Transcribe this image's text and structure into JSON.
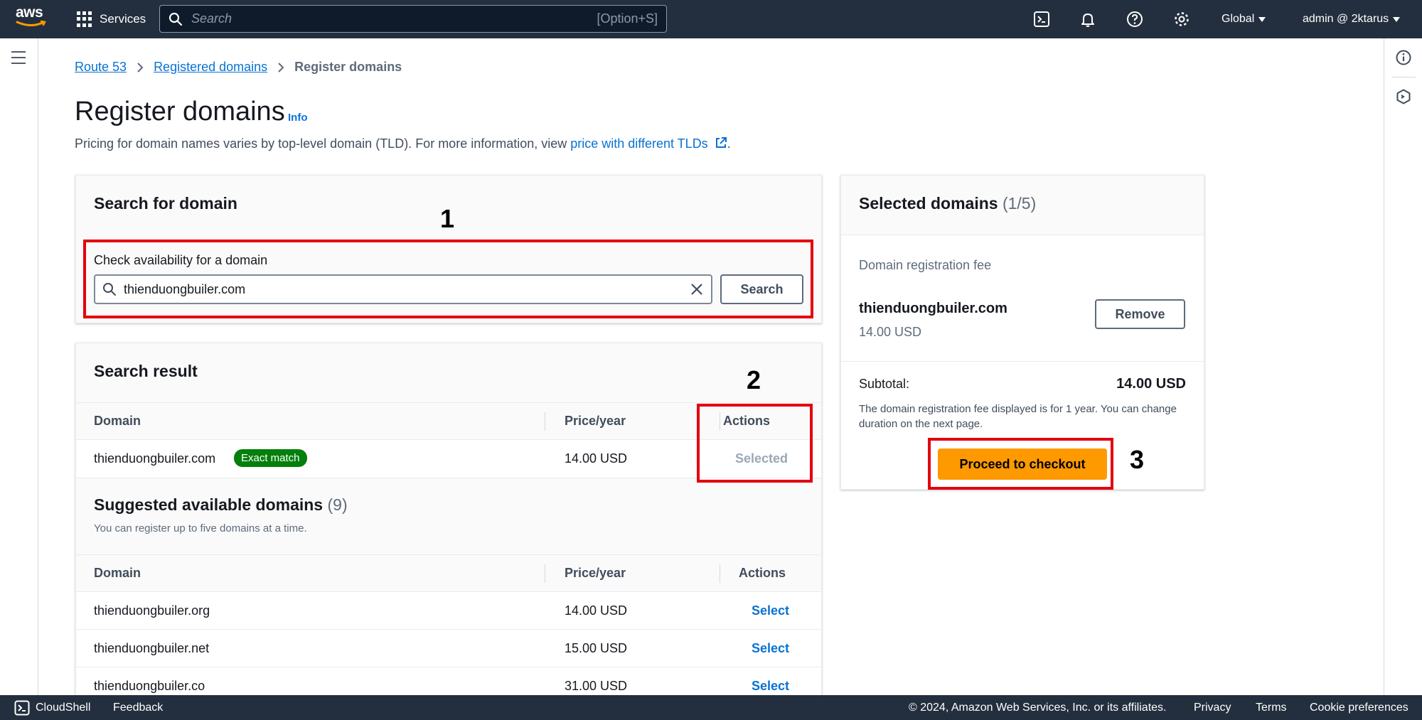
{
  "topnav": {
    "logo_text": "aws",
    "services_label": "Services",
    "search_placeholder": "Search",
    "search_shortcut": "[Option+S]",
    "region_label": "Global",
    "account_label": "admin @ 2ktarus"
  },
  "breadcrumb": {
    "items": [
      "Route 53",
      "Registered domains"
    ],
    "current": "Register domains"
  },
  "page": {
    "title": "Register domains",
    "info_label": "Info",
    "description_prefix": "Pricing for domain names varies by top-level domain (TLD). For more information, view ",
    "description_link": "price with different TLDs",
    "description_suffix": "."
  },
  "search_panel": {
    "title": "Search for domain",
    "field_label": "Check availability for a domain",
    "field_value": "thienduongbuiler.com",
    "search_button": "Search"
  },
  "search_result": {
    "title": "Search result",
    "columns": [
      "Domain",
      "Price/year",
      "Actions"
    ],
    "row": {
      "domain": "thienduongbuiler.com",
      "badge": "Exact match",
      "price": "14.00 USD",
      "action": "Selected"
    }
  },
  "suggested": {
    "title": "Suggested available domains",
    "count": "(9)",
    "subtitle": "You can register up to five domains at a time.",
    "columns": [
      "Domain",
      "Price/year",
      "Actions"
    ],
    "rows": [
      {
        "domain": "thienduongbuiler.org",
        "price": "14.00 USD",
        "action": "Select"
      },
      {
        "domain": "thienduongbuiler.net",
        "price": "15.00 USD",
        "action": "Select"
      },
      {
        "domain": "thienduongbuiler.co",
        "price": "31.00 USD",
        "action": "Select"
      }
    ]
  },
  "selected_panel": {
    "title": "Selected domains",
    "count": "(1/5)",
    "fee_label": "Domain registration fee",
    "domain": "thienduongbuiler.com",
    "domain_price": "14.00 USD",
    "remove_button": "Remove",
    "subtotal_label": "Subtotal:",
    "subtotal_value": "14.00 USD",
    "note": "The domain registration fee displayed is for 1 year. You can change duration on the next page.",
    "checkout_button": "Proceed to checkout"
  },
  "annotations": [
    "1",
    "2",
    "3"
  ],
  "footer": {
    "cloudshell": "CloudShell",
    "feedback": "Feedback",
    "copyright": "© 2024, Amazon Web Services, Inc. or its affiliates.",
    "privacy": "Privacy",
    "terms": "Terms",
    "cookies": "Cookie preferences"
  },
  "colors": {
    "nav_bg": "#232f3e",
    "link": "#0972d3",
    "primary_button": "#ff9900",
    "badge_green": "#037f0c",
    "annotation_red": "#e3000f"
  }
}
